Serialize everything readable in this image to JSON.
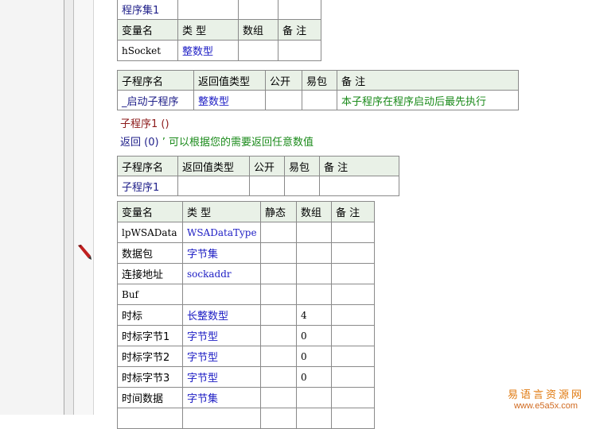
{
  "table_top": {
    "row_program_set": "程序集1",
    "headers": [
      "变量名",
      "类 型",
      "数组",
      "备 注"
    ],
    "row": {
      "name": "hSocket",
      "type": "整数型",
      "array": "",
      "note": ""
    }
  },
  "table_sub_start": {
    "headers": [
      "子程序名",
      "返回值类型",
      "公开",
      "易包",
      "备 注"
    ],
    "row": {
      "name": "_启动子程序",
      "ret": "整数型",
      "public": "",
      "epkg": "",
      "note": "本子程序在程序启动后最先执行"
    }
  },
  "code_lines": {
    "sub_call": "子程序1 ()",
    "return_keyword": "返回 (0)",
    "return_comment": "’ 可以根据您的需要返回任意数值"
  },
  "table_sub1": {
    "headers": [
      "子程序名",
      "返回值类型",
      "公开",
      "易包",
      "备 注"
    ],
    "row": {
      "name": "子程序1",
      "ret": "",
      "public": "",
      "epkg": "",
      "note": ""
    }
  },
  "table_vars": {
    "headers": [
      "变量名",
      "类 型",
      "静态",
      "数组",
      "备 注"
    ],
    "rows": [
      {
        "name": "lpWSAData",
        "type": "WSADataType",
        "static": "",
        "array": "",
        "note": ""
      },
      {
        "name": "数据包",
        "type": "字节集",
        "static": "",
        "array": "",
        "note": ""
      },
      {
        "name": "连接地址",
        "type": "sockaddr",
        "static": "",
        "array": "",
        "note": ""
      },
      {
        "name": "Buf",
        "type": "",
        "static": "",
        "array": "",
        "note": ""
      },
      {
        "name": "时标",
        "type": "长整数型",
        "static": "",
        "array": "4",
        "note": ""
      },
      {
        "name": "时标字节1",
        "type": "字节型",
        "static": "",
        "array": "0",
        "note": ""
      },
      {
        "name": "时标字节2",
        "type": "字节型",
        "static": "",
        "array": "0",
        "note": ""
      },
      {
        "name": "时标字节3",
        "type": "字节型",
        "static": "",
        "array": "0",
        "note": ""
      },
      {
        "name": "时间数据",
        "type": "字节集",
        "static": "",
        "array": "",
        "note": ""
      }
    ]
  },
  "watermark": {
    "title": "易语言资源网",
    "url": "www.e5a5x.com"
  },
  "icons": {
    "edit_marker": "pencil-icon"
  }
}
